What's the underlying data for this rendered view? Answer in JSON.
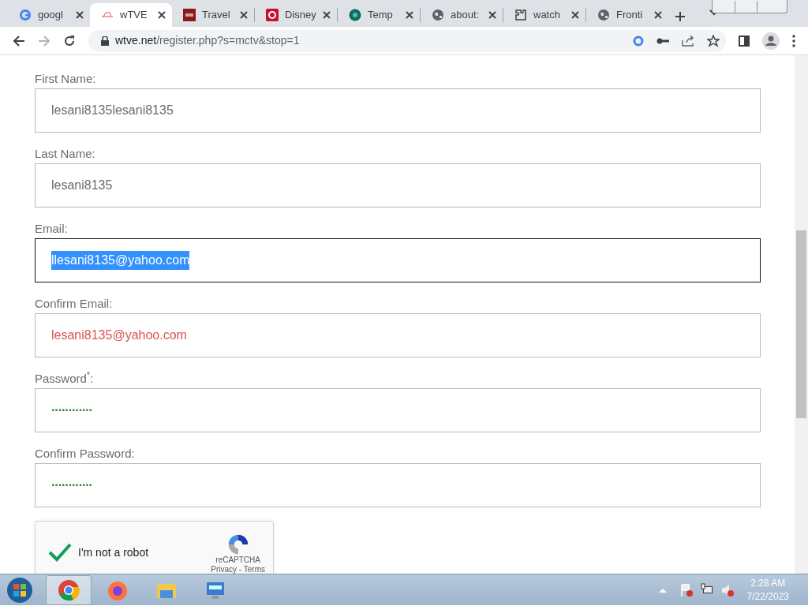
{
  "tabs": [
    {
      "label": "googl",
      "selected": false
    },
    {
      "label": "wTVE",
      "selected": true
    },
    {
      "label": "Travel",
      "selected": false
    },
    {
      "label": "Disney",
      "selected": false
    },
    {
      "label": "Temp",
      "selected": false
    },
    {
      "label": "about:",
      "selected": false
    },
    {
      "label": "watch",
      "selected": false
    },
    {
      "label": "Fronti",
      "selected": false
    }
  ],
  "address": {
    "host": "wtve.net",
    "path": "/register.php?s=mctv&stop=1"
  },
  "form": {
    "fields": [
      {
        "label": "First Name:",
        "value": "lesani8135lesani8135",
        "focused": false,
        "invalid": false,
        "kind": "text",
        "text_selected": false
      },
      {
        "label": "Last Name:",
        "value": "lesani8135",
        "focused": false,
        "invalid": false,
        "kind": "text",
        "text_selected": false
      },
      {
        "label": "Email:",
        "value": "llesani8135@yahoo.com",
        "focused": true,
        "invalid": false,
        "kind": "text",
        "text_selected": true
      },
      {
        "label": "Confirm Email:",
        "value": "lesani8135@yahoo.com",
        "focused": false,
        "invalid": true,
        "kind": "text",
        "text_selected": false
      },
      {
        "label": "Password$^{*}$:",
        "value": "············",
        "focused": false,
        "invalid": false,
        "kind": "password",
        "text_selected": false
      },
      {
        "label": "Confirm Password:",
        "value": "············",
        "focused": false,
        "invalid": false,
        "kind": "password",
        "text_selected": false
      }
    ],
    "captcha": {
      "label": "I'm not a robot",
      "checked": true,
      "brand": "reCAPTCHA",
      "links": "Privacy - Terms"
    }
  },
  "taskbar": {
    "apps": [
      {
        "selected": true
      },
      {
        "selected": false
      },
      {
        "selected": false
      },
      {
        "selected": false
      }
    ],
    "time": "2:28 AM",
    "date": "7/22/2023"
  }
}
